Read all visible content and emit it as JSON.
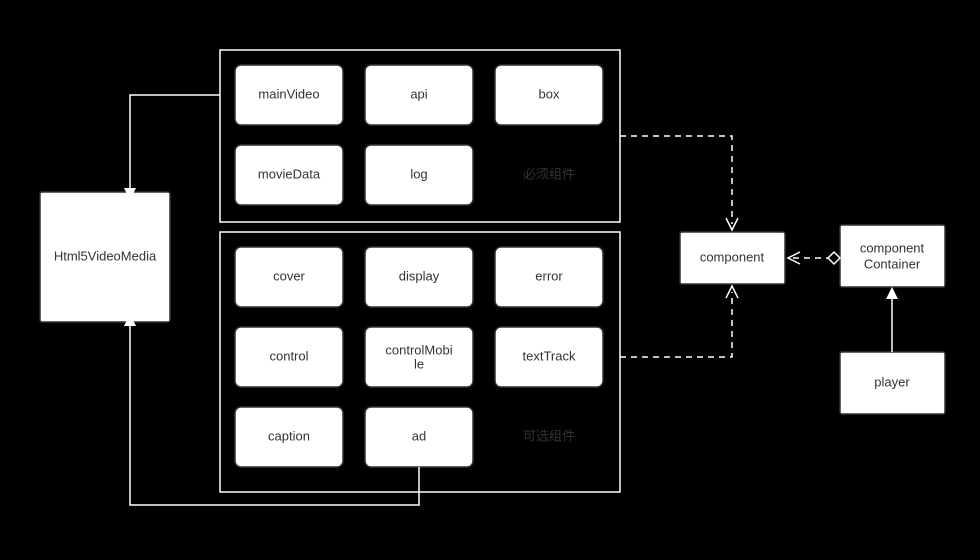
{
  "nodes": {
    "html5": "Html5VideoMedia",
    "component": "component",
    "componentContainer1": "component",
    "componentContainer2": "Container",
    "player": "player",
    "requiredLabel": "必须组件",
    "optionalLabel": "可选组件",
    "mainVideo": "mainVideo",
    "api": "api",
    "box": "box",
    "movieData": "movieData",
    "log": "log",
    "cover": "cover",
    "display": "display",
    "error": "error",
    "control": "control",
    "controlMobile1": "controlMobi",
    "controlMobile2": "le",
    "textTrack": "textTrack",
    "caption": "caption",
    "ad": "ad"
  }
}
